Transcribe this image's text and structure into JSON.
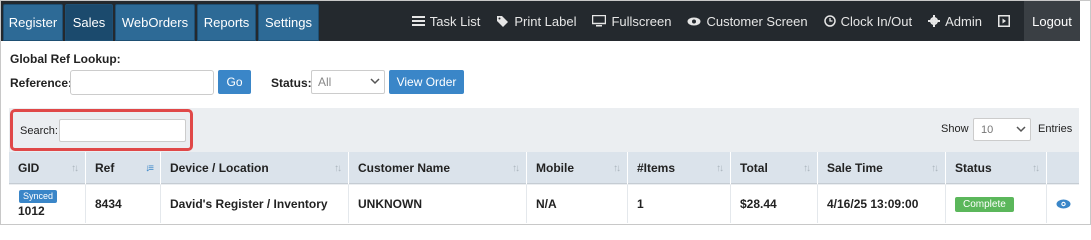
{
  "nav": {
    "tabs": [
      "Register",
      "Sales",
      "WebOrders",
      "Reports",
      "Settings"
    ],
    "active_tab": "Sales",
    "task_list": "Task List",
    "print_label": "Print Label",
    "fullscreen": "Fullscreen",
    "customer_screen": "Customer Screen",
    "clock": "Clock In/Out",
    "admin": "Admin",
    "logout": "Logout"
  },
  "lookup": {
    "title": "Global Ref Lookup:",
    "reference_label": "Reference:",
    "reference_value": "",
    "go_label": "Go",
    "status_label": "Status:",
    "status_value": "All",
    "view_order_label": "View Order"
  },
  "table_controls": {
    "search_label": "Search:",
    "search_value": "",
    "show_label": "Show",
    "show_value": "10",
    "entries_label": "Entries"
  },
  "table": {
    "columns": [
      "GID",
      "Ref",
      "Device / Location",
      "Customer Name",
      "Mobile",
      "#Items",
      "Total",
      "Sale Time",
      "Status",
      ""
    ],
    "sorted_column": "Ref",
    "rows": [
      {
        "synced_badge": "Synced",
        "gid": "1012",
        "ref": "8434",
        "device": "David's Register / Inventory",
        "customer": "UNKNOWN",
        "mobile": "N/A",
        "items": "1",
        "total": "$28.44",
        "sale_time": "4/16/25 13:09:00",
        "status": "Complete"
      }
    ]
  },
  "colors": {
    "navbar": "#24292e",
    "nav_button": "#2d6a96",
    "primary_button": "#3a86c8",
    "complete": "#5bb75b",
    "highlight": "#e04848"
  }
}
